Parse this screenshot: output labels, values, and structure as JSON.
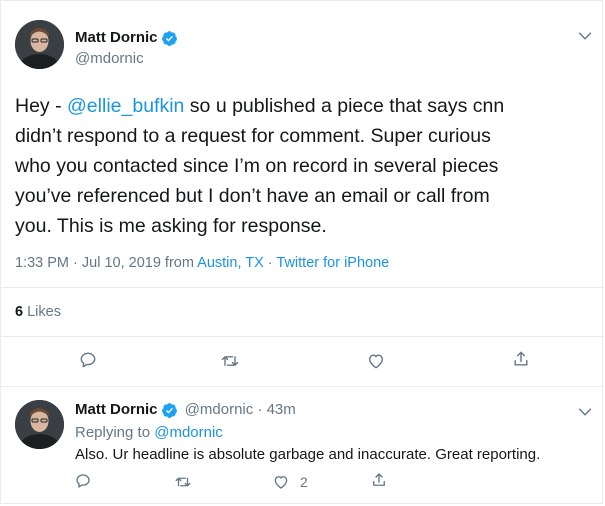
{
  "tweet": {
    "author_name": "Matt Dornic",
    "author_handle": "@mdornic",
    "text_before_mention": "Hey - ",
    "mention": "@ellie_bufkin",
    "text_line1_rest": " so u published a piece that says cnn",
    "text_lines": [
      "didn’t respond to a request for comment. Super curious",
      "who you contacted since I’m on record in several pieces",
      "you’ve referenced but I don’t have an email or call from",
      "you. This is me asking for response."
    ],
    "meta_time": "1:33 PM · Jul 10, 2019 from ",
    "meta_location": "Austin, TX",
    "meta_sep": " · ",
    "meta_client": "Twitter for iPhone",
    "likes_count": "6",
    "likes_label": " Likes",
    "accent_color": "#1b95e0"
  },
  "reply": {
    "author_name": "Matt Dornic",
    "author_handle": "@mdornic",
    "time_sep": " · ",
    "time": "43m",
    "replying_to_label": "Replying to ",
    "replying_to_handle": "@mdornic",
    "text": "Also. Ur headline is absolute garbage and inaccurate.  Great reporting.",
    "like_count": "2"
  },
  "icons": [
    "chevron-down-icon",
    "verified-badge-icon",
    "reply-icon",
    "retweet-icon",
    "like-icon",
    "share-icon"
  ]
}
